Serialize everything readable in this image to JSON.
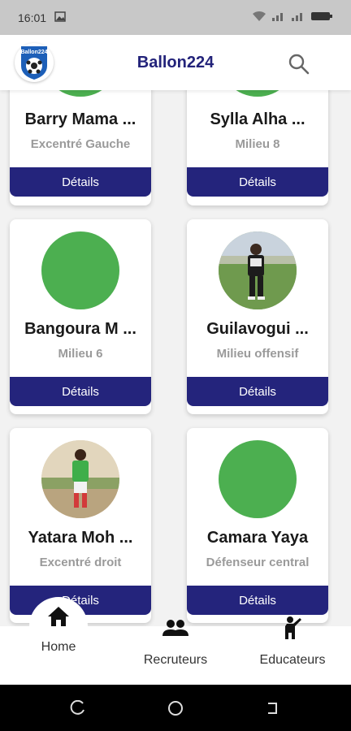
{
  "status_bar": {
    "time": "16:01"
  },
  "app_bar": {
    "title": "Ballon224",
    "logo_text": "Ballon224"
  },
  "players": [
    {
      "name": "Barry Mama ...",
      "position": "Excentré Gauche",
      "details_label": "Détails",
      "photo": "none"
    },
    {
      "name": "Sylla Alha ...",
      "position": "Milieu 8",
      "details_label": "Détails",
      "photo": "none"
    },
    {
      "name": "Bangoura M ...",
      "position": "Milieu 6",
      "details_label": "Détails",
      "photo": "none"
    },
    {
      "name": "Guilavogui ...",
      "position": "Milieu offensif",
      "details_label": "Détails",
      "photo": "player-photo"
    },
    {
      "name": "Yatara Moh ...",
      "position": "Excentré droit",
      "details_label": "Détails",
      "photo": "player-photo"
    },
    {
      "name": "Camara Yaya",
      "position": "Défenseur central",
      "details_label": "Détails",
      "photo": "none"
    }
  ],
  "bottom_nav": {
    "home": "Home",
    "recruiters": "Recruteurs",
    "educators": "Educateurs"
  },
  "colors": {
    "primary": "#24247c",
    "placeholder": "#4caf50",
    "title": "#23237a"
  }
}
